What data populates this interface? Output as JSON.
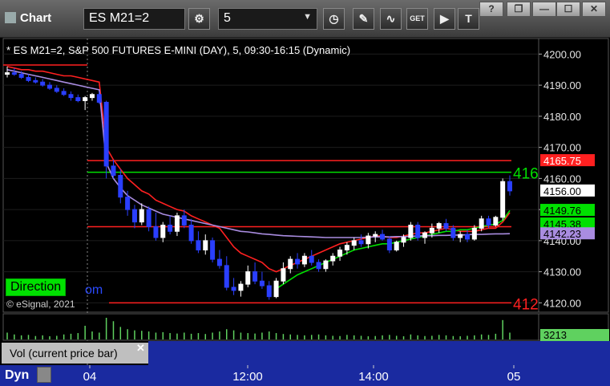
{
  "toolbar": {
    "title": "Chart",
    "symbol": "ES M21=2",
    "interval": "5",
    "window_controls": [
      "?",
      "❐",
      "—",
      "☐",
      "✕"
    ]
  },
  "chart_header": "* ES M21=2, S&P 500 FUTURES E-MINI (DAY), 5, 09:30-16:15 (Dynamic)",
  "copyright": "© eSignal, 2021",
  "direction_label": "Direction",
  "direction_tail": "om",
  "colors": {
    "background": "#000000",
    "up_candle": "#ffffff",
    "down_candle": "#2a3fff",
    "red_line": "#ff2020",
    "green_line": "#00e000",
    "purple_line": "#a98ce0",
    "vol_bars": "#5fd15f",
    "time_axis_bg": "#1a2aa0"
  },
  "chart_data": {
    "type": "candlestick",
    "title": "* ES M21=2, S&P 500 FUTURES E-MINI (DAY), 5, 09:30-16:15 (Dynamic)",
    "y_ticks": [
      "4200.00",
      "4190.00",
      "4180.00",
      "4170.00",
      "4160.00",
      "4150.00",
      "4140.00",
      "4130.00",
      "4120.00"
    ],
    "ylim": [
      4117,
      4205
    ],
    "x_ticks": [
      "04",
      "12:00",
      "14:00",
      "05"
    ],
    "price_labels": [
      {
        "text": "4165.75",
        "value": 4165.75,
        "bg": "#ff2020",
        "fg": "#ffffff"
      },
      {
        "text": "4156.00",
        "value": 4156.0,
        "bg": "#ffffff",
        "fg": "#000000"
      },
      {
        "text": "4149.76",
        "value": 4149.76,
        "bg": "#00e000",
        "fg": "#000000"
      },
      {
        "text": "4145.38",
        "value": 4145.38,
        "bg": "#00e000",
        "fg": "#000000"
      },
      {
        "text": "4142.23",
        "value": 4142.23,
        "bg": "#a98ce0",
        "fg": "#000000"
      }
    ],
    "levels": [
      {
        "value": 4196.5,
        "color": "#ff2020",
        "label": ""
      },
      {
        "value": 4165.75,
        "color": "#ff2020",
        "label": ""
      },
      {
        "value": 4162.0,
        "color": "#00e000",
        "label": "416"
      },
      {
        "value": 4144.5,
        "color": "#ff2020",
        "label": ""
      },
      {
        "value": 4120.0,
        "color": "#ff2020",
        "label": "412"
      }
    ],
    "candles": [
      [
        4193.5,
        4196,
        4192.5,
        4194
      ],
      [
        4194,
        4195.5,
        4193,
        4193.5
      ],
      [
        4193.5,
        4194.5,
        4192,
        4192.5
      ],
      [
        4192.5,
        4193.5,
        4191,
        4191.5
      ],
      [
        4191.5,
        4192.5,
        4190.5,
        4191
      ],
      [
        4191,
        4192,
        4189.5,
        4190
      ],
      [
        4190,
        4191,
        4188.5,
        4189
      ],
      [
        4189,
        4190,
        4187.5,
        4188
      ],
      [
        4188,
        4189,
        4186.5,
        4187
      ],
      [
        4187,
        4188,
        4185,
        4186
      ],
      [
        4186,
        4187,
        4184.5,
        4185
      ],
      [
        4185,
        4186.5,
        4182,
        4186
      ],
      [
        4186,
        4187.5,
        4185,
        4187
      ],
      [
        4187,
        4188,
        4184,
        4184.5
      ],
      [
        4184.5,
        4185,
        4160,
        4164
      ],
      [
        4164,
        4166,
        4160,
        4161
      ],
      [
        4161,
        4163,
        4152,
        4154
      ],
      [
        4154,
        4156,
        4148,
        4150
      ],
      [
        4150,
        4151.5,
        4144,
        4146
      ],
      [
        4146,
        4152,
        4145,
        4150
      ],
      [
        4150,
        4151,
        4143,
        4144.5
      ],
      [
        4144.5,
        4149,
        4140,
        4141
      ],
      [
        4141,
        4146,
        4139.5,
        4145
      ],
      [
        4145,
        4148,
        4142,
        4143
      ],
      [
        4143,
        4149,
        4141.5,
        4148
      ],
      [
        4148,
        4150,
        4144,
        4145
      ],
      [
        4145,
        4147,
        4139,
        4140
      ],
      [
        4140,
        4143,
        4136,
        4137
      ],
      [
        4137,
        4142,
        4135.5,
        4140
      ],
      [
        4140,
        4141,
        4133,
        4134
      ],
      [
        4134,
        4137,
        4131,
        4132
      ],
      [
        4132,
        4135,
        4124,
        4125
      ],
      [
        4125,
        4128,
        4122.5,
        4124
      ],
      [
        4124,
        4127,
        4122,
        4126
      ],
      [
        4126,
        4132,
        4125,
        4130
      ],
      [
        4130,
        4133,
        4126,
        4127
      ],
      [
        4127,
        4130,
        4124.5,
        4125.5
      ],
      [
        4125.5,
        4127,
        4121,
        4122
      ],
      [
        4122,
        4128,
        4121.5,
        4127
      ],
      [
        4127,
        4133,
        4126,
        4131
      ],
      [
        4131,
        4135,
        4129.5,
        4134
      ],
      [
        4134,
        4136,
        4131,
        4132.5
      ],
      [
        4132.5,
        4136,
        4131.5,
        4135
      ],
      [
        4135,
        4137,
        4132,
        4133
      ],
      [
        4133,
        4134,
        4130,
        4131
      ],
      [
        4131,
        4134,
        4130,
        4133.5
      ],
      [
        4133.5,
        4136,
        4132,
        4135
      ],
      [
        4135,
        4138,
        4133.5,
        4137
      ],
      [
        4137,
        4139.5,
        4135.5,
        4138.5
      ],
      [
        4138.5,
        4141,
        4137,
        4140
      ],
      [
        4140,
        4142,
        4138,
        4139
      ],
      [
        4139,
        4142.5,
        4137.5,
        4141.5
      ],
      [
        4141.5,
        4143,
        4139.5,
        4142
      ],
      [
        4142,
        4143.5,
        4140,
        4140.5
      ],
      [
        4140.5,
        4141.5,
        4136,
        4137
      ],
      [
        4137,
        4140,
        4136.5,
        4139.5
      ],
      [
        4139.5,
        4142,
        4138,
        4141
      ],
      [
        4141,
        4146,
        4140,
        4145
      ],
      [
        4145,
        4146,
        4140,
        4141
      ],
      [
        4141,
        4143,
        4139,
        4142.5
      ],
      [
        4142.5,
        4145.5,
        4141,
        4144
      ],
      [
        4144,
        4146,
        4142.5,
        4145.5
      ],
      [
        4145.5,
        4147,
        4143,
        4144
      ],
      [
        4144,
        4145,
        4140,
        4141
      ],
      [
        4141,
        4143,
        4139.5,
        4142
      ],
      [
        4142,
        4143.5,
        4139.5,
        4140.5
      ],
      [
        4140.5,
        4145,
        4140,
        4144
      ],
      [
        4144,
        4148,
        4143,
        4147
      ],
      [
        4147,
        4148,
        4144,
        4145
      ],
      [
        4145,
        4148,
        4144.5,
        4147.5
      ],
      [
        4147.5,
        4160,
        4146.5,
        4159
      ],
      [
        4159,
        4161,
        4154.5,
        4156
      ]
    ],
    "indicators": [
      {
        "name": "",
        "color": "#ff2020",
        "values": [
          4196,
          4195.5,
          4195,
          4195,
          4194.5,
          4194.5,
          4194,
          4193.5,
          4193,
          4193,
          4192.5,
          4192,
          4191.5,
          4191,
          4170,
          4166,
          4163,
          4160,
          4158,
          4156,
          4155,
          4153,
          4152,
          4151,
          4150,
          4149.5,
          4148,
          4147,
          4146,
          4145,
          4144,
          4141,
          4138,
          4136,
          4135,
          4134,
          4133,
          4131,
          4130,
          4131,
          4132,
          4133,
          4134,
          4135,
          4136,
          4137,
          4138,
          4139,
          4139.5,
          4140,
          4140.5,
          4141,
          4141.5,
          4141.5,
          4141,
          4141,
          4141.5,
          4142,
          4142.5,
          4142.5,
          4143,
          4143.5,
          4144,
          4143.5,
          4143,
          4143,
          4143,
          4143.5,
          4144,
          4144,
          4146,
          4149
        ]
      },
      {
        "name": "",
        "color": "#00e000",
        "values": [
          null,
          null,
          null,
          null,
          null,
          null,
          null,
          null,
          null,
          null,
          null,
          null,
          null,
          null,
          null,
          null,
          null,
          null,
          null,
          null,
          null,
          null,
          null,
          null,
          null,
          null,
          null,
          null,
          null,
          null,
          null,
          null,
          null,
          null,
          null,
          null,
          null,
          null,
          4124.5,
          4126,
          4127.5,
          4129,
          4130,
          4131,
          4132,
          4133,
          4134,
          4135,
          4136,
          4137,
          4137.5,
          4138,
          4138.5,
          4139,
          4139,
          4139.5,
          4140,
          4140.5,
          4141,
          4141.5,
          4142,
          4142.5,
          4143,
          4143,
          4143.5,
          4143.5,
          4144,
          4144.5,
          4145,
          4145.3,
          4146.5,
          4149.7
        ]
      },
      {
        "name": "",
        "color": "#a98ce0",
        "values": [
          4195,
          4194.5,
          4194,
          4193.5,
          4193,
          4192.5,
          4192,
          4191.5,
          4191,
          4190.5,
          4190,
          4189.5,
          4189,
          4188.5,
          4165,
          4160,
          4157,
          4154.5,
          4153,
          4151.5,
          4150.5,
          4149.5,
          4148.5,
          4148,
          4147.5,
          4147,
          4146.5,
          4146,
          4145.5,
          4145,
          4144.5,
          4144,
          4143.5,
          4143,
          4142.8,
          4142.5,
          4142.2,
          4142,
          4141.8,
          4141.6,
          4141.5,
          4141.4,
          4141.3,
          4141.2,
          4141.1,
          4141,
          4141,
          4141,
          4141,
          4141,
          4141,
          4141.1,
          4141.2,
          4141.2,
          4141.2,
          4141.3,
          4141.3,
          4141.4,
          4141.5,
          4141.6,
          4141.6,
          4141.7,
          4141.7,
          4141.8,
          4141.8,
          4141.9,
          4142,
          4142,
          4142.1,
          4142.2,
          4142.2,
          4142.23
        ]
      }
    ],
    "volume": {
      "label": "Vol (current price bar)",
      "last_value": "3213",
      "values": [
        30,
        22,
        18,
        20,
        15,
        18,
        14,
        16,
        22,
        25,
        28,
        60,
        35,
        30,
        95,
        80,
        55,
        45,
        40,
        38,
        35,
        30,
        32,
        28,
        26,
        30,
        25,
        28,
        24,
        30,
        35,
        45,
        40,
        30,
        28,
        26,
        30,
        35,
        28,
        24,
        22,
        20,
        18,
        20,
        22,
        18,
        16,
        15,
        20,
        18,
        16,
        14,
        15,
        18,
        20,
        16,
        14,
        22,
        18,
        15,
        16,
        20,
        18,
        15,
        14,
        16,
        18,
        22,
        20,
        25,
        85,
        30
      ]
    }
  },
  "timezone_label": "Dyn"
}
